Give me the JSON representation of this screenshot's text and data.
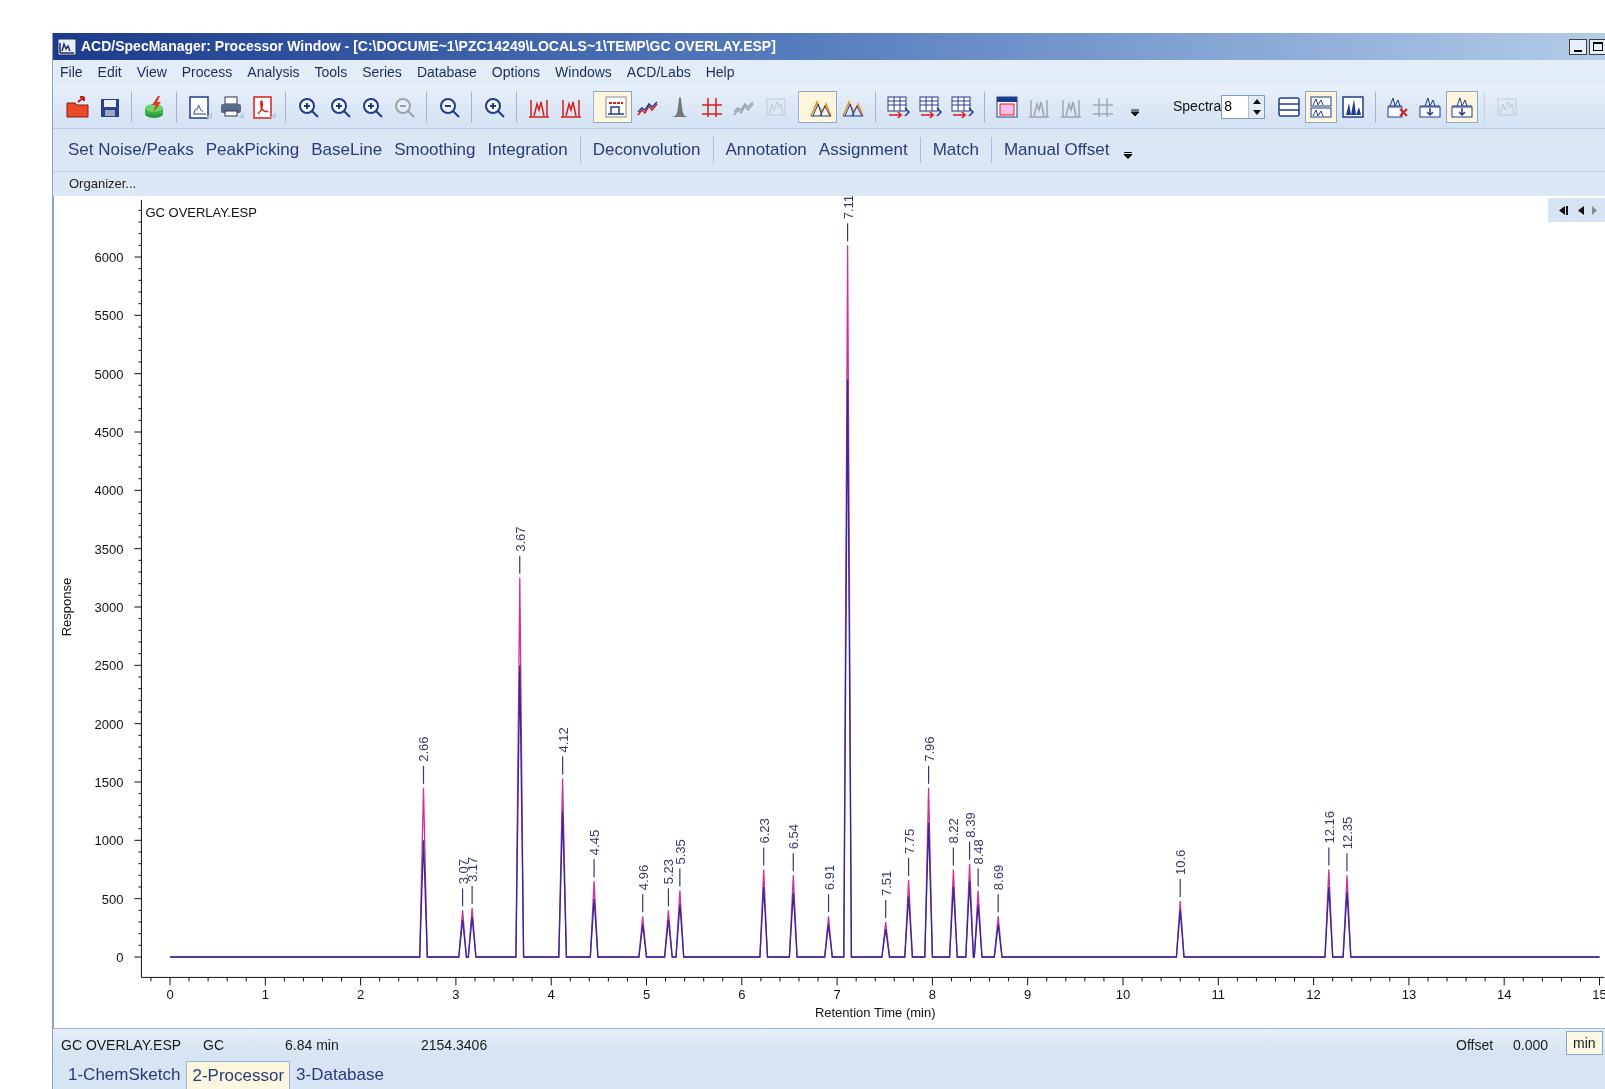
{
  "window": {
    "title": "ACD/SpecManager: Processor Window - [C:\\DOCUME~1\\PZC14249\\LOCALS~1\\TEMP\\GC OVERLAY.ESP]"
  },
  "menu": [
    "File",
    "Edit",
    "View",
    "Process",
    "Analysis",
    "Tools",
    "Series",
    "Database",
    "Options",
    "Windows",
    "ACD/Labs",
    "Help"
  ],
  "toolbar": [
    {
      "pressed": false,
      "disabled": false,
      "group_start": false
    },
    {
      "pressed": false,
      "disabled": false,
      "group_start": false
    },
    {
      "pressed": false,
      "disabled": false,
      "group_start": true
    },
    {
      "pressed": false,
      "disabled": false,
      "group_start": true
    },
    {
      "pressed": false,
      "disabled": false,
      "group_start": false
    },
    {
      "pressed": false,
      "disabled": false,
      "group_start": false
    },
    {
      "pressed": false,
      "disabled": false,
      "group_start": true
    },
    {
      "pressed": false,
      "disabled": false,
      "group_start": false
    },
    {
      "pressed": false,
      "disabled": false,
      "group_start": false
    },
    {
      "pressed": false,
      "disabled": true,
      "group_start": false
    },
    {
      "pressed": false,
      "disabled": false,
      "group_start": true
    },
    {
      "pressed": false,
      "disabled": false,
      "group_start": true
    },
    {
      "pressed": false,
      "disabled": false,
      "group_start": true
    },
    {
      "pressed": false,
      "disabled": false,
      "group_start": false
    },
    {
      "pressed": true,
      "disabled": false,
      "group_start": true
    },
    {
      "pressed": false,
      "disabled": false,
      "group_start": false
    },
    {
      "pressed": false,
      "disabled": false,
      "group_start": false
    },
    {
      "pressed": false,
      "disabled": false,
      "group_start": false
    },
    {
      "pressed": false,
      "disabled": true,
      "group_start": false
    },
    {
      "pressed": false,
      "disabled": true,
      "group_start": false
    },
    {
      "pressed": true,
      "disabled": false,
      "group_start": true
    },
    {
      "pressed": false,
      "disabled": false,
      "group_start": false
    },
    {
      "pressed": false,
      "disabled": false,
      "group_start": true
    },
    {
      "pressed": false,
      "disabled": false,
      "group_start": false
    },
    {
      "pressed": false,
      "disabled": false,
      "group_start": false
    },
    {
      "pressed": false,
      "disabled": false,
      "group_start": true
    },
    {
      "pressed": false,
      "disabled": true,
      "group_start": false
    },
    {
      "pressed": false,
      "disabled": true,
      "group_start": false
    },
    {
      "pressed": false,
      "disabled": true,
      "group_start": false
    }
  ],
  "spectra": {
    "label": "Spectra",
    "value": "8"
  },
  "view_buttons": [
    {
      "pressed": false,
      "group_start": false
    },
    {
      "pressed": true,
      "group_start": false
    },
    {
      "pressed": false,
      "group_start": false
    },
    {
      "pressed": false,
      "group_start": true
    },
    {
      "pressed": false,
      "group_start": false
    },
    {
      "pressed": true,
      "group_start": false
    },
    {
      "pressed": false,
      "group_start": true
    }
  ],
  "process_bar": [
    {
      "label": "Set Noise/Peaks",
      "separator_before": false
    },
    {
      "label": "PeakPicking",
      "separator_before": false
    },
    {
      "label": "BaseLine",
      "separator_before": false
    },
    {
      "label": "Smoothing",
      "separator_before": false
    },
    {
      "label": "Integration",
      "separator_before": false
    },
    {
      "label": "Deconvolution",
      "separator_before": true
    },
    {
      "label": "Annotation",
      "separator_before": true
    },
    {
      "label": "Assignment",
      "separator_before": false
    },
    {
      "label": "Match",
      "separator_before": true
    },
    {
      "label": "Manual Offset",
      "separator_before": true
    }
  ],
  "organizer": "Organizer...",
  "spectrum": {
    "title": "GC OVERLAY.ESP",
    "chart_data": {
      "type": "line",
      "xlabel": "Retention Time (min)",
      "ylabel": "Response",
      "x": [
        0,
        2.62,
        2.66,
        2.7,
        3.03,
        3.07,
        3.11,
        3.13,
        3.17,
        3.21,
        3.63,
        3.67,
        3.71,
        4.08,
        4.12,
        4.16,
        4.41,
        4.45,
        4.49,
        4.92,
        4.96,
        5.0,
        5.19,
        5.23,
        5.27,
        5.31,
        5.35,
        5.39,
        6.19,
        6.23,
        6.27,
        6.5,
        6.54,
        6.58,
        6.87,
        6.91,
        6.95,
        7.07,
        7.11,
        7.15,
        7.47,
        7.51,
        7.55,
        7.71,
        7.75,
        7.79,
        7.92,
        7.96,
        8.0,
        8.18,
        8.22,
        8.26,
        8.35,
        8.39,
        8.43,
        8.44,
        8.48,
        8.52,
        8.65,
        8.69,
        8.73,
        10.56,
        10.6,
        10.64,
        12.12,
        12.16,
        12.2,
        12.31,
        12.35,
        12.39,
        15
      ],
      "series": [
        {
          "color": "#d0309a",
          "values": [
            0,
            0,
            1450,
            0,
            0,
            400,
            0,
            0,
            420,
            0,
            0,
            3250,
            0,
            0,
            1530,
            0,
            0,
            650,
            0,
            0,
            350,
            0,
            0,
            400,
            0,
            0,
            570,
            0,
            0,
            750,
            0,
            0,
            700,
            0,
            0,
            350,
            0,
            0,
            6100,
            0,
            0,
            300,
            0,
            0,
            660,
            0,
            0,
            1450,
            0,
            0,
            750,
            0,
            0,
            800,
            0,
            0,
            570,
            0,
            0,
            350,
            0,
            0,
            480,
            0,
            0,
            750,
            0,
            0,
            700,
            0,
            0
          ]
        },
        {
          "color": "#2b2b9a",
          "values": [
            0,
            0,
            1000,
            0,
            0,
            320,
            0,
            0,
            340,
            0,
            0,
            2500,
            0,
            0,
            1250,
            0,
            0,
            500,
            0,
            0,
            280,
            0,
            0,
            320,
            0,
            0,
            450,
            0,
            0,
            600,
            0,
            0,
            550,
            0,
            0,
            280,
            0,
            0,
            4950,
            0,
            0,
            240,
            0,
            0,
            520,
            0,
            0,
            1150,
            0,
            0,
            600,
            0,
            0,
            650,
            0,
            0,
            450,
            0,
            0,
            280,
            0,
            0,
            400,
            0,
            0,
            600,
            0,
            0,
            560,
            0,
            0
          ]
        }
      ],
      "xlim": [
        -0.3,
        15.05
      ],
      "ylim": [
        -175,
        6490
      ],
      "xticks": [
        0,
        1,
        2,
        3,
        4,
        5,
        6,
        7,
        8,
        9,
        10,
        11,
        12,
        13,
        14,
        15
      ],
      "yticks": [
        0,
        500,
        1000,
        1500,
        2000,
        2500,
        3000,
        3500,
        4000,
        4500,
        5000,
        5500,
        6000
      ],
      "annotations": [
        {
          "x": 2.66,
          "y": 1450,
          "text": "2.66"
        },
        {
          "x": 3.07,
          "y": 400,
          "text": "3.07"
        },
        {
          "x": 3.17,
          "y": 420,
          "text": "3.17"
        },
        {
          "x": 3.67,
          "y": 3250,
          "text": "3.67"
        },
        {
          "x": 4.12,
          "y": 1530,
          "text": "4.12"
        },
        {
          "x": 4.45,
          "y": 650,
          "text": "4.45"
        },
        {
          "x": 4.96,
          "y": 350,
          "text": "4.96"
        },
        {
          "x": 5.23,
          "y": 400,
          "text": "5.23"
        },
        {
          "x": 5.35,
          "y": 570,
          "text": "5.35"
        },
        {
          "x": 6.23,
          "y": 750,
          "text": "6.23"
        },
        {
          "x": 6.54,
          "y": 700,
          "text": "6.54"
        },
        {
          "x": 6.91,
          "y": 350,
          "text": "6.91"
        },
        {
          "x": 7.11,
          "y": 6100,
          "text": "7.11"
        },
        {
          "x": 7.51,
          "y": 300,
          "text": "7.51"
        },
        {
          "x": 7.75,
          "y": 660,
          "text": "7.75"
        },
        {
          "x": 7.96,
          "y": 1450,
          "text": "7.96"
        },
        {
          "x": 8.22,
          "y": 750,
          "text": "8.22"
        },
        {
          "x": 8.39,
          "y": 800,
          "text": "8.39"
        },
        {
          "x": 8.48,
          "y": 570,
          "text": "8.48"
        },
        {
          "x": 8.69,
          "y": 350,
          "text": "8.69"
        },
        {
          "x": 10.6,
          "y": 480,
          "text": "10.6"
        },
        {
          "x": 12.16,
          "y": 750,
          "text": "12.16"
        },
        {
          "x": 12.35,
          "y": 700,
          "text": "12.35"
        }
      ]
    }
  },
  "status_bar": [
    "GC OVERLAY.ESP",
    "GC",
    "6.84 min",
    "2154.3406"
  ],
  "offset": {
    "label": "Offset",
    "value": "0.000",
    "unit": "min"
  },
  "tabs": [
    {
      "label": "1-ChemSketch",
      "selected": false
    },
    {
      "label": "2-Processor",
      "selected": true
    },
    {
      "label": "3-Database",
      "selected": false
    }
  ]
}
